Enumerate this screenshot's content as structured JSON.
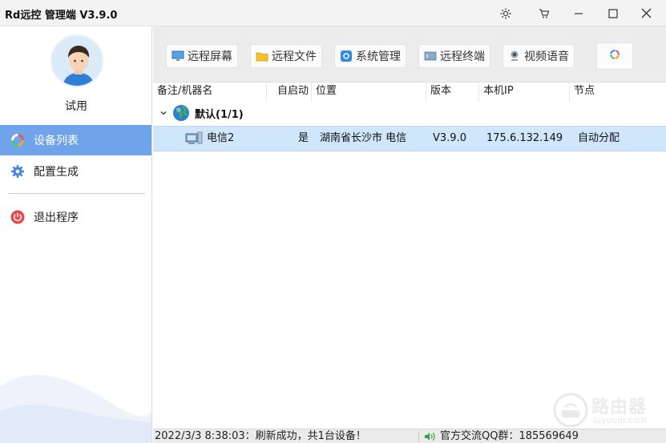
{
  "window": {
    "title": "Rd远控  管理端 V3.9.0"
  },
  "sidebar": {
    "user_name": "试用",
    "items": [
      {
        "label": "设备列表",
        "icon": "loading-ring-icon",
        "active": true
      },
      {
        "label": "配置生成",
        "icon": "gear-icon",
        "active": false
      },
      {
        "label": "退出程序",
        "icon": "power-icon",
        "active": false
      }
    ]
  },
  "toolbar": {
    "buttons": [
      {
        "label": "远程屏幕",
        "icon": "monitor-icon"
      },
      {
        "label": "远程文件",
        "icon": "folder-icon"
      },
      {
        "label": "系统管理",
        "icon": "settings-icon"
      },
      {
        "label": "远程终端",
        "icon": "terminal-icon"
      },
      {
        "label": "视频语音",
        "icon": "webcam-icon"
      }
    ],
    "refresh_icon": "refresh-ring-icon"
  },
  "table": {
    "columns": [
      "备注/机器名",
      "自启动",
      "位置",
      "版本",
      "本机IP",
      "节点"
    ],
    "group": {
      "label": "默认(1/1)",
      "icon": "globe-icon"
    },
    "rows": [
      {
        "name": "电信2",
        "autostart": "是",
        "location": "湖南省长沙市 电信",
        "version": "V3.9.0",
        "ip": "175.6.132.149",
        "node": "自动分配"
      }
    ]
  },
  "status": {
    "message": "2022/3/3 8:38:03：刷新成功，共1台设备！",
    "qq_text": "官方交流QQ群：185569649"
  },
  "watermark": {
    "text": "路由器",
    "sub": "luyouqi.com"
  },
  "colors": {
    "accent": "#6fa4ea",
    "row_selected": "#cfe6fb",
    "power_red": "#e54b4b"
  }
}
